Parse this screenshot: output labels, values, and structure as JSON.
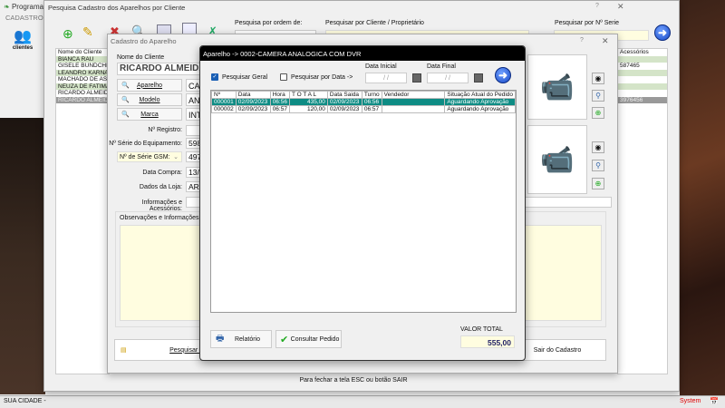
{
  "app": {
    "title": "Programa C",
    "menu": "CADASTROS",
    "clientes": "clientes",
    "status_left": "SUA CIDADE -",
    "status_right": "System",
    "footer": "Para fechar a tela ESC ou botão SAIR"
  },
  "search_window": {
    "title": "Pesquisa Cadastro dos Aparelhos por Cliente",
    "order_label": "Pesquisa por ordem de:",
    "client_label": "Pesquisar por Cliente / Proprietário",
    "serial_label": "Pesquisar por Nº Serie",
    "help": "?",
    "close": "✕",
    "list_header": "Nome do Cliente",
    "clients": [
      "BIANCA RAU",
      "GISELE BUNDCHEN",
      "LEANDRO KARNAL",
      "MACHADO DE ASSIS",
      "NEUZA DE FATIMA",
      "RICARDO ALMEIDA",
      "RICARDO ALMEIDA"
    ],
    "right_col": {
      "header": "Acessórios",
      "v1": "587465",
      "v2": "3976456"
    }
  },
  "cadastro": {
    "title": "Cadastro do Aparelho",
    "help": "?",
    "close": "✕",
    "client_label": "Nome do Cliente",
    "client_value": "RICARDO ALMEIDA J",
    "buttons": {
      "aparelho": "Aparelho",
      "modelo": "Modelo",
      "marca": "Marca"
    },
    "values": {
      "aparelho": "CAM",
      "modelo": "ANA",
      "marca": "INT",
      "serie": "598",
      "gsm": "497",
      "data_compra": "13/",
      "loja": "ARA"
    },
    "labels": {
      "registro": "Nº Registro:",
      "serie": "Nº Série do Equipamento:",
      "gsm": "Nº de Série GSM:",
      "data_compra": "Data Compra:",
      "loja": "Dados da Loja:",
      "info": "Informações e Acessórios:",
      "obs": "Observações e Informações Com"
    },
    "pesquisar": "Pesquisar S",
    "sair": "Sair do Cadastro"
  },
  "pedidos": {
    "title": "Aparelho -> 0002-CAMERA ANALOGICA COM DVR",
    "geral": "Pesquisar Geral",
    "geral_checked": true,
    "por_data": "Pesquisar por Data  ->",
    "por_data_checked": false,
    "data_inicial_label": "Data Inicial",
    "data_final_label": "Data Final",
    "data_inicial": "/ /",
    "data_final": "/ /",
    "columns": [
      "Nº",
      "Data",
      "Hora",
      "T O T A L",
      "Data Saida",
      "Turno",
      "Vendedor",
      "Situação Atual do Pedido"
    ],
    "rows": [
      [
        "000001",
        "02/09/2023",
        "06:56",
        "435,00",
        "02/09/2023",
        "06:56",
        "",
        "Aguardando Aprovação"
      ],
      [
        "000002",
        "02/09/2023",
        "06:57",
        "120,00",
        "02/09/2023",
        "06:57",
        "",
        "Aguardando Aprovação"
      ]
    ],
    "relatorio": "Relatório",
    "consultar": "Consultar Pedido",
    "valor_total_label": "VALOR TOTAL",
    "valor_total": "555,00"
  }
}
